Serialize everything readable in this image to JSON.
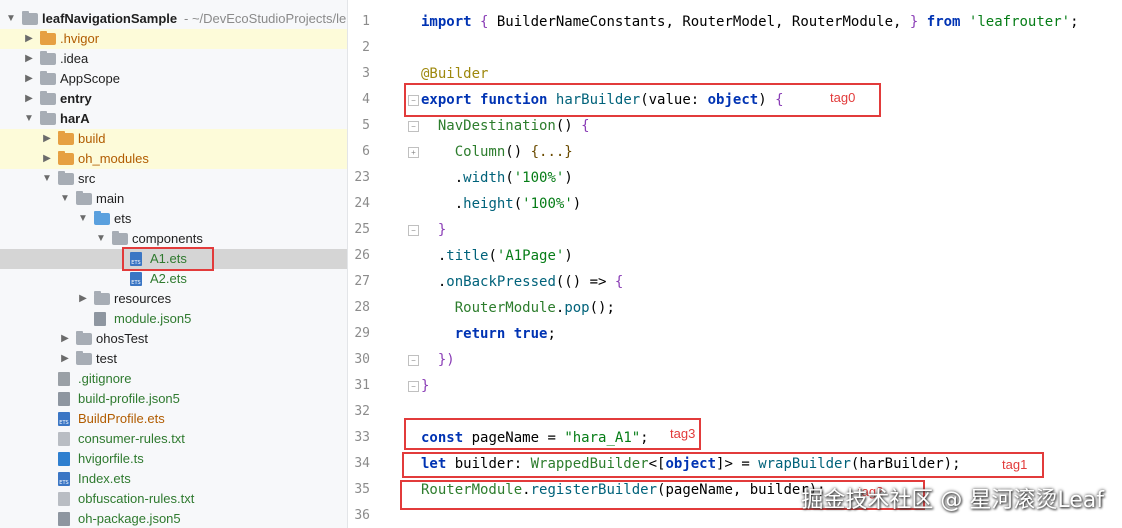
{
  "project_tree": {
    "root": {
      "name": "leafNavigationSample",
      "path": "- ~/DevEcoStudioProjects/le"
    },
    "items": [
      {
        "name": ".hvigor",
        "depth": 1,
        "expander": "closed",
        "icon": "folder-orange-icon"
      },
      {
        "name": ".idea",
        "depth": 1,
        "expander": "closed",
        "icon": "folder-gray-icon"
      },
      {
        "name": "AppScope",
        "depth": 1,
        "expander": "closed",
        "icon": "folder-gray-icon"
      },
      {
        "name": "entry",
        "depth": 1,
        "expander": "closed",
        "icon": "module-folder-icon"
      },
      {
        "name": "harA",
        "depth": 1,
        "expander": "open",
        "icon": "module-folder-icon"
      },
      {
        "name": "build",
        "depth": 2,
        "expander": "closed",
        "icon": "folder-orange-icon"
      },
      {
        "name": "oh_modules",
        "depth": 2,
        "expander": "closed",
        "icon": "folder-orange-icon"
      },
      {
        "name": "src",
        "depth": 2,
        "expander": "open",
        "icon": "folder-gray-icon"
      },
      {
        "name": "main",
        "depth": 3,
        "expander": "open",
        "icon": "folder-gray-icon"
      },
      {
        "name": "ets",
        "depth": 4,
        "expander": "open",
        "icon": "folder-blue-icon"
      },
      {
        "name": "components",
        "depth": 5,
        "expander": "open",
        "icon": "folder-gray-icon"
      },
      {
        "name": "A1.ets",
        "depth": 6,
        "expander": "none",
        "icon": "ets-file-icon"
      },
      {
        "name": "A2.ets",
        "depth": 6,
        "expander": "none",
        "icon": "ets-file-icon"
      },
      {
        "name": "resources",
        "depth": 4,
        "expander": "closed",
        "icon": "folder-gray-icon"
      },
      {
        "name": "module.json5",
        "depth": 4,
        "expander": "none",
        "icon": "json-file-icon"
      },
      {
        "name": "ohosTest",
        "depth": 3,
        "expander": "closed",
        "icon": "folder-gray-icon"
      },
      {
        "name": "test",
        "depth": 3,
        "expander": "closed",
        "icon": "folder-gray-icon"
      },
      {
        "name": ".gitignore",
        "depth": 2,
        "expander": "none",
        "icon": "gitignore-file-icon"
      },
      {
        "name": "build-profile.json5",
        "depth": 2,
        "expander": "none",
        "icon": "json-file-icon"
      },
      {
        "name": "BuildProfile.ets",
        "depth": 2,
        "expander": "none",
        "icon": "ets-file-icon"
      },
      {
        "name": "consumer-rules.txt",
        "depth": 2,
        "expander": "none",
        "icon": "text-file-icon"
      },
      {
        "name": "hvigorfile.ts",
        "depth": 2,
        "expander": "none",
        "icon": "ts-file-icon"
      },
      {
        "name": "Index.ets",
        "depth": 2,
        "expander": "none",
        "icon": "ets-file-icon"
      },
      {
        "name": "obfuscation-rules.txt",
        "depth": 2,
        "expander": "none",
        "icon": "text-file-icon"
      },
      {
        "name": "oh-package.json5",
        "depth": 2,
        "expander": "none",
        "icon": "json-file-icon"
      }
    ]
  },
  "editor": {
    "lines": [
      {
        "n": "1",
        "tokens": [
          [
            "kw",
            "import"
          ],
          [
            "plain",
            " "
          ],
          [
            "brace",
            "{"
          ],
          [
            "plain",
            " BuilderNameConstants, RouterModel, RouterModule, "
          ],
          [
            "brace",
            "}"
          ],
          [
            "plain",
            " "
          ],
          [
            "kw",
            "from"
          ],
          [
            "plain",
            " "
          ],
          [
            "str",
            "'leafrouter'"
          ],
          [
            "plain",
            ";"
          ]
        ]
      },
      {
        "n": "2",
        "tokens": []
      },
      {
        "n": "3",
        "tokens": [
          [
            "ann",
            "@Builder"
          ]
        ]
      },
      {
        "n": "4",
        "tokens": [
          [
            "kw",
            "export"
          ],
          [
            "plain",
            " "
          ],
          [
            "kw",
            "function"
          ],
          [
            "plain",
            " "
          ],
          [
            "fn",
            "harBuilder"
          ],
          [
            "plain",
            "(value: "
          ],
          [
            "kw",
            "object"
          ],
          [
            "plain",
            ") "
          ],
          [
            "brace",
            "{"
          ]
        ]
      },
      {
        "n": "5",
        "tokens": [
          [
            "plain",
            "  "
          ],
          [
            "kw2",
            "NavDestination"
          ],
          [
            "plain",
            "() "
          ],
          [
            "brace",
            "{"
          ]
        ]
      },
      {
        "n": "6",
        "tokens": [
          [
            "plain",
            "    "
          ],
          [
            "kw2",
            "Column"
          ],
          [
            "plain",
            "() "
          ],
          [
            "colt",
            "{...}"
          ]
        ]
      },
      {
        "n": "23",
        "tokens": [
          [
            "plain",
            "    ."
          ],
          [
            "mtd",
            "width"
          ],
          [
            "plain",
            "("
          ],
          [
            "str",
            "'100%'"
          ],
          [
            "plain",
            ")"
          ]
        ]
      },
      {
        "n": "24",
        "tokens": [
          [
            "plain",
            "    ."
          ],
          [
            "mtd",
            "height"
          ],
          [
            "plain",
            "("
          ],
          [
            "str",
            "'100%'"
          ],
          [
            "plain",
            ")"
          ]
        ]
      },
      {
        "n": "25",
        "tokens": [
          [
            "plain",
            "  "
          ],
          [
            "brace",
            "}"
          ]
        ]
      },
      {
        "n": "26",
        "tokens": [
          [
            "plain",
            "  ."
          ],
          [
            "mtd",
            "title"
          ],
          [
            "plain",
            "("
          ],
          [
            "str",
            "'A1Page'"
          ],
          [
            "plain",
            ")"
          ]
        ]
      },
      {
        "n": "27",
        "tokens": [
          [
            "plain",
            "  ."
          ],
          [
            "mtd",
            "onBackPressed"
          ],
          [
            "plain",
            "(() => "
          ],
          [
            "brace",
            "{"
          ]
        ]
      },
      {
        "n": "28",
        "tokens": [
          [
            "plain",
            "    "
          ],
          [
            "kw2",
            "RouterModule"
          ],
          [
            "plain",
            "."
          ],
          [
            "mtd",
            "pop"
          ],
          [
            "plain",
            "();"
          ]
        ]
      },
      {
        "n": "29",
        "tokens": [
          [
            "plain",
            "    "
          ],
          [
            "kw",
            "return"
          ],
          [
            "plain",
            " "
          ],
          [
            "kw",
            "true"
          ],
          [
            "plain",
            ";"
          ]
        ]
      },
      {
        "n": "30",
        "tokens": [
          [
            "plain",
            "  "
          ],
          [
            "brace",
            "})"
          ]
        ]
      },
      {
        "n": "31",
        "tokens": [
          [
            "brace",
            "}"
          ]
        ]
      },
      {
        "n": "32",
        "tokens": []
      },
      {
        "n": "33",
        "tokens": [
          [
            "kw",
            "const"
          ],
          [
            "plain",
            " pageName = "
          ],
          [
            "str",
            "\"hara_A1\""
          ],
          [
            "plain",
            ";"
          ]
        ]
      },
      {
        "n": "34",
        "tokens": [
          [
            "kw",
            "let"
          ],
          [
            "plain",
            " builder: "
          ],
          [
            "kw2",
            "WrappedBuilder"
          ],
          [
            "plain",
            "<["
          ],
          [
            "kw",
            "object"
          ],
          [
            "plain",
            "]> = "
          ],
          [
            "fn",
            "wrapBuilder"
          ],
          [
            "plain",
            "(harBuilder);"
          ]
        ]
      },
      {
        "n": "35",
        "tokens": [
          [
            "kw2",
            "RouterModule"
          ],
          [
            "plain",
            "."
          ],
          [
            "mtd",
            "registerBuilder"
          ],
          [
            "plain",
            "(pageName, builder);"
          ]
        ]
      },
      {
        "n": "36",
        "tokens": []
      }
    ]
  },
  "tags": {
    "tag0": "tag0",
    "tag1": "tag1",
    "tag3": "tag3",
    "tag2": "tag2"
  },
  "watermark": "掘金技术社区 @ 星河滚烫Leaf"
}
